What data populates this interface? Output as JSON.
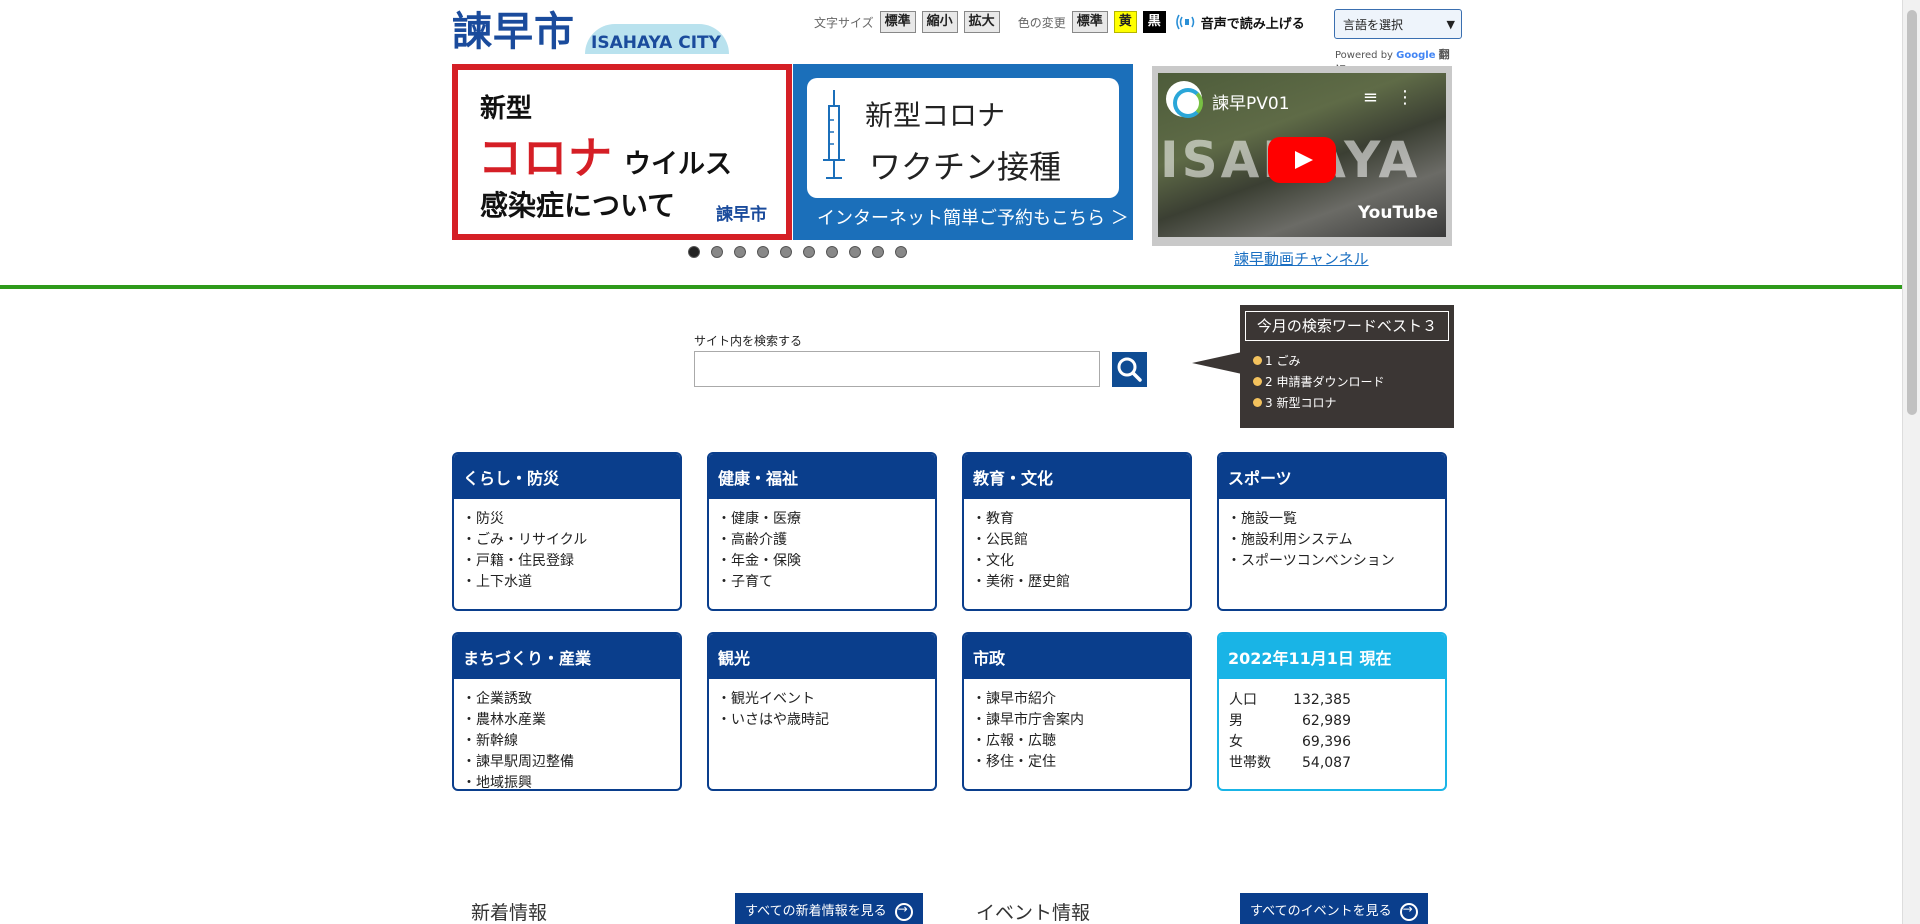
{
  "header": {
    "logo_jp": "諫早市",
    "logo_en": "ISAHAYA CITY",
    "font_size_label": "文字サイズ",
    "font_size_buttons": [
      "標準",
      "縮小",
      "拡大"
    ],
    "color_label": "色の変更",
    "color_buttons": [
      "標準",
      "黄",
      "黒"
    ],
    "speak_label": "音声で読み上げる",
    "language_select": "言語を選択",
    "powered_by": "Powered by",
    "google": "Google",
    "translate": "翻訳"
  },
  "banner": {
    "left_slide": {
      "line1": "新型",
      "line2_red": "コロナ",
      "line2_rest": "ウイルス",
      "line3": "感染症について",
      "city": "諫早市"
    },
    "right_slide": {
      "line1": "新型コロナ",
      "line2": "ワクチン接種",
      "bottom": "インターネット簡単ご予約もこちら ＞"
    },
    "dot_count": 10,
    "active_dot": 0
  },
  "video": {
    "title": "諫早PV01",
    "bg_text": "ISAHAYA",
    "youtube_label": "YouTube",
    "link_text": "諫早動画チャンネル"
  },
  "search": {
    "label": "サイト内を検索する",
    "placeholder": ""
  },
  "best_words": {
    "title": "今月の検索ワードベスト３",
    "items": [
      "1 ごみ",
      "2 申請書ダウンロード",
      "3 新型コロナ"
    ]
  },
  "categories": [
    {
      "title": "くらし・防災",
      "items": [
        "・防災",
        "・ごみ・リサイクル",
        "・戸籍・住民登録",
        "・上下水道"
      ]
    },
    {
      "title": "健康・福祉",
      "items": [
        "・健康・医療",
        "・高齢介護",
        "・年金・保険",
        "・子育て"
      ]
    },
    {
      "title": "教育・文化",
      "items": [
        "・教育",
        "・公民館",
        "・文化",
        "・美術・歴史館"
      ]
    },
    {
      "title": "スポーツ",
      "items": [
        "・施設一覧",
        "・施設利用システム",
        "・スポーツコンベンション"
      ]
    },
    {
      "title": "まちづくり・産業",
      "items": [
        "・企業誘致",
        "・農林水産業",
        "・新幹線",
        "・諫早駅周辺整備",
        "・地域振興"
      ]
    },
    {
      "title": "観光",
      "items": [
        "・観光イベント",
        "・いさはや歳時記"
      ]
    },
    {
      "title": "市政",
      "items": [
        "・諫早市紹介",
        "・諫早市庁舎案内",
        "・広報・広聴",
        "・移住・定住"
      ]
    }
  ],
  "population": {
    "title": "2022年11月1日 現在",
    "rows": [
      {
        "label": "人口",
        "value": "132,385"
      },
      {
        "label": "男",
        "value": "62,989"
      },
      {
        "label": "女",
        "value": "69,396"
      },
      {
        "label": "世帯数",
        "value": "54,087"
      }
    ]
  },
  "news": {
    "new_info_title": "新着情報",
    "new_info_button": "すべての新着情報を見る",
    "event_title": "イベント情報",
    "event_button": "すべてのイベントを見る"
  },
  "colors": {
    "brand_blue": "#0a3e8c",
    "accent_green": "#2e9a1b",
    "red": "#d51f26",
    "cyan": "#19b4e6"
  }
}
